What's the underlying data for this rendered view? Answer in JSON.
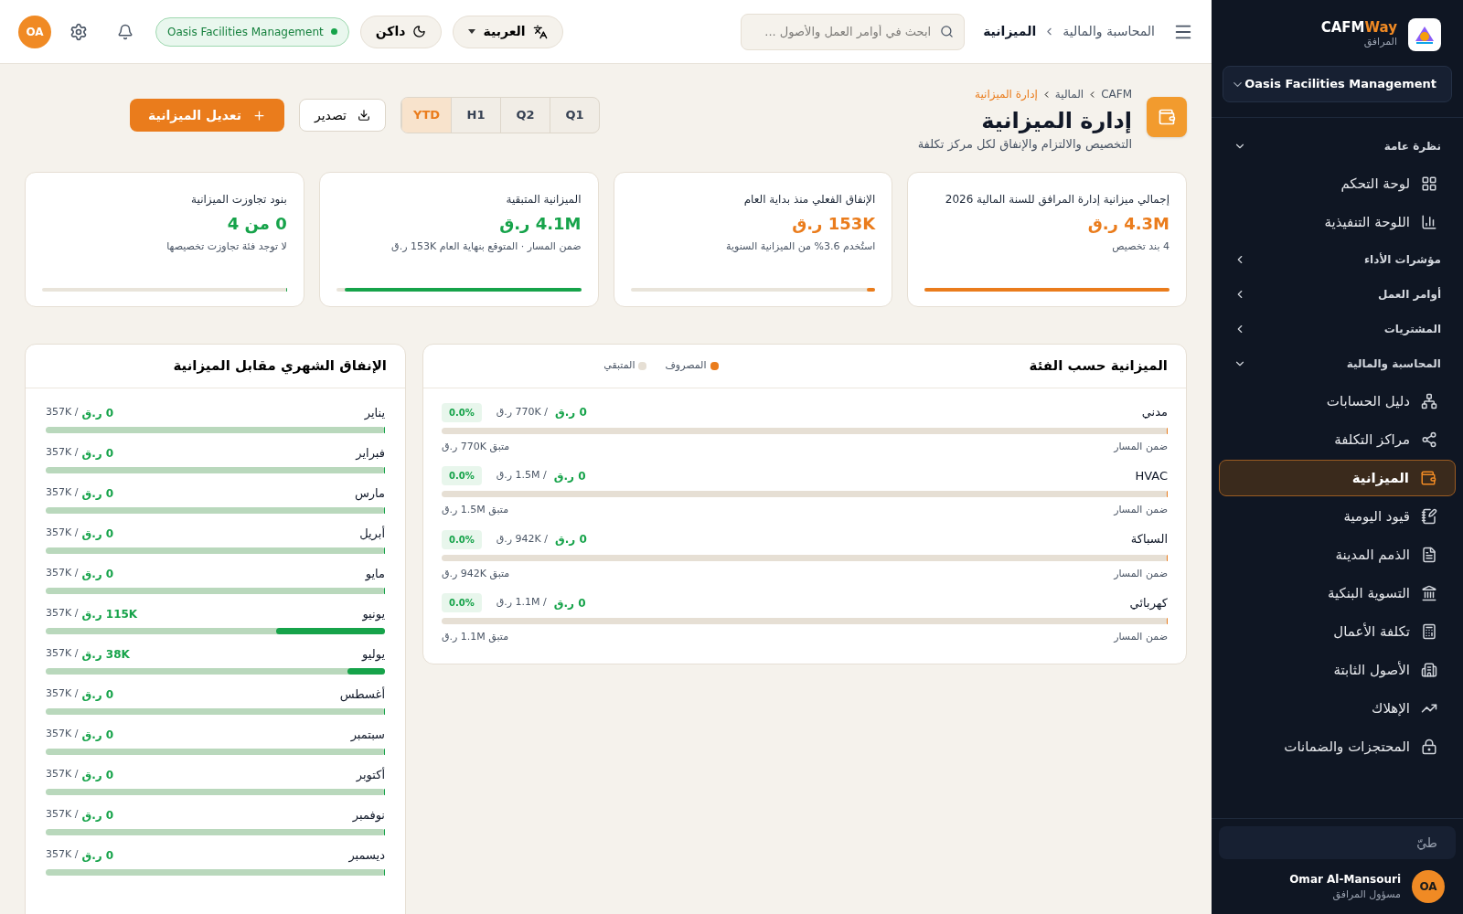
{
  "topbar": {
    "breadcrumb": [
      "المحاسبة والمالية",
      "الميزانية"
    ],
    "search": {
      "placeholder": "ابحث في أوامر العمل والأصول ..."
    },
    "language": "العربية",
    "theme": "داكن",
    "org_badge": "Oasis Facilities Management",
    "avatar": "OA"
  },
  "header": {
    "breadcrumb": [
      "CAFM",
      "المالية",
      "إدارة الميزانية"
    ],
    "title": "إدارة الميزانية",
    "subtitle": "التخصيص والالتزام والإنفاق لكل مركز تكلفة",
    "periods": [
      {
        "label": "Q1",
        "selected": false
      },
      {
        "label": "Q2",
        "selected": false
      },
      {
        "label": "H1",
        "selected": false
      },
      {
        "label": "YTD",
        "selected": true
      }
    ],
    "export_button": "تصدير",
    "edit_button": "تعديل الميزانية"
  },
  "kpis": [
    {
      "label": "إجمالي ميزانية إدارة المرافق للسنة المالية 2026",
      "value": "4.3M ر.ق",
      "note": "4 بند تخصيص",
      "color": "#ea7c1c",
      "level": 1
    },
    {
      "label": "الإنفاق الفعلي منذ بداية العام",
      "value": "153K ر.ق",
      "note": "استُخدم 3.6% من الميزانية السنوية",
      "color": "#ea7c1c",
      "level": 0.036
    },
    {
      "label": "الميزانية المتبقية",
      "value": "4.1M ر.ق",
      "note": "ضمن المسار · المتوقع بنهاية العام 153K ر.ق",
      "color": "#16a34a",
      "level": 0.964
    },
    {
      "label": "بنود تجاوزت الميزانية",
      "value": "0 من 4",
      "note": "لا توجد فئة تجاوزت تخصيصها",
      "color": "#16a34a",
      "level": 0
    }
  ],
  "categories": {
    "title": "الميزانية حسب الفئة",
    "legend": [
      {
        "label": "المصروف",
        "color": "#ea7c1c"
      },
      {
        "label": "المتبقي",
        "color": "#e6dfd4"
      }
    ],
    "rows": [
      {
        "name": "مدني",
        "spent": "0 ر.ق",
        "budget": "/ 770K ر.ق",
        "percent": "0.0%",
        "status": "ضمن المسار",
        "remaining": "متبق 770K ر.ق",
        "level": 0
      },
      {
        "name": "HVAC",
        "spent": "0 ر.ق",
        "budget": "/ 1.5M ر.ق",
        "percent": "0.0%",
        "status": "ضمن المسار",
        "remaining": "متبق 1.5M ر.ق",
        "level": 0
      },
      {
        "name": "السباكة",
        "spent": "0 ر.ق",
        "budget": "/ 942K ر.ق",
        "percent": "0.0%",
        "status": "ضمن المسار",
        "remaining": "متبق 942K ر.ق",
        "level": 0
      },
      {
        "name": "كهربائي",
        "spent": "0 ر.ق",
        "budget": "/ 1.1M ر.ق",
        "percent": "0.0%",
        "status": "ضمن المسار",
        "remaining": "متبق 1.1M ر.ق",
        "level": 0
      }
    ]
  },
  "monthly": {
    "title": "الإنفاق الشهري مقابل الميزانية",
    "rows": [
      {
        "month": "يناير",
        "spent": "0 ر.ق",
        "budget": "/ 357K",
        "level": 0
      },
      {
        "month": "فبراير",
        "spent": "0 ر.ق",
        "budget": "/ 357K",
        "level": 0
      },
      {
        "month": "مارس",
        "spent": "0 ر.ق",
        "budget": "/ 357K",
        "level": 0
      },
      {
        "month": "أبريل",
        "spent": "0 ر.ق",
        "budget": "/ 357K",
        "level": 0
      },
      {
        "month": "مايو",
        "spent": "0 ر.ق",
        "budget": "/ 357K",
        "level": 0
      },
      {
        "month": "يونيو",
        "spent": "115K ر.ق",
        "budget": "/ 357K",
        "level": 0.32
      },
      {
        "month": "يوليو",
        "spent": "38K ر.ق",
        "budget": "/ 357K",
        "level": 0.11
      },
      {
        "month": "أغسطس",
        "spent": "0 ر.ق",
        "budget": "/ 357K",
        "level": 0
      },
      {
        "month": "سبتمبر",
        "spent": "0 ر.ق",
        "budget": "/ 357K",
        "level": 0
      },
      {
        "month": "أكتوبر",
        "spent": "0 ر.ق",
        "budget": "/ 357K",
        "level": 0
      },
      {
        "month": "نوفمبر",
        "spent": "0 ر.ق",
        "budget": "/ 357K",
        "level": 0
      },
      {
        "month": "ديسمبر",
        "spent": "0 ر.ق",
        "budget": "/ 357K",
        "level": 0
      }
    ]
  },
  "sidebar": {
    "brand": {
      "name_a": "CAFM",
      "name_b": "Way",
      "subtitle": "المرافق"
    },
    "org_select": "Oasis Facilities Management",
    "sections": [
      {
        "title": "نظرة عامة",
        "expanded": true,
        "items": [
          {
            "label": "لوحة التحكم",
            "selected": false
          },
          {
            "label": "اللوحة التنفيذية",
            "selected": false
          }
        ]
      },
      {
        "title": "مؤشرات الأداء",
        "expanded": false
      },
      {
        "title": "أوامر العمل",
        "expanded": false
      },
      {
        "title": "المشتريات",
        "expanded": false
      },
      {
        "title": "المحاسبة والمالية",
        "expanded": true,
        "items": [
          {
            "label": "دليل الحسابات",
            "selected": false
          },
          {
            "label": "مراكز التكلفة",
            "selected": false
          },
          {
            "label": "الميزانية",
            "selected": true
          },
          {
            "label": "قيود اليومية",
            "selected": false
          },
          {
            "label": "الذمم المدينة",
            "selected": false
          },
          {
            "label": "التسوية البنكية",
            "selected": false
          },
          {
            "label": "تكلفة الأعمال",
            "selected": false
          },
          {
            "label": "الأصول الثابتة",
            "selected": false
          },
          {
            "label": "الإهلاك",
            "selected": false
          },
          {
            "label": "المحتجزات والضمانات",
            "selected": false
          }
        ]
      }
    ],
    "collapse": "طيّ",
    "user": {
      "name": "Omar Al-Mansouri",
      "role": "مسؤول المرافق",
      "initials": "OA"
    }
  }
}
